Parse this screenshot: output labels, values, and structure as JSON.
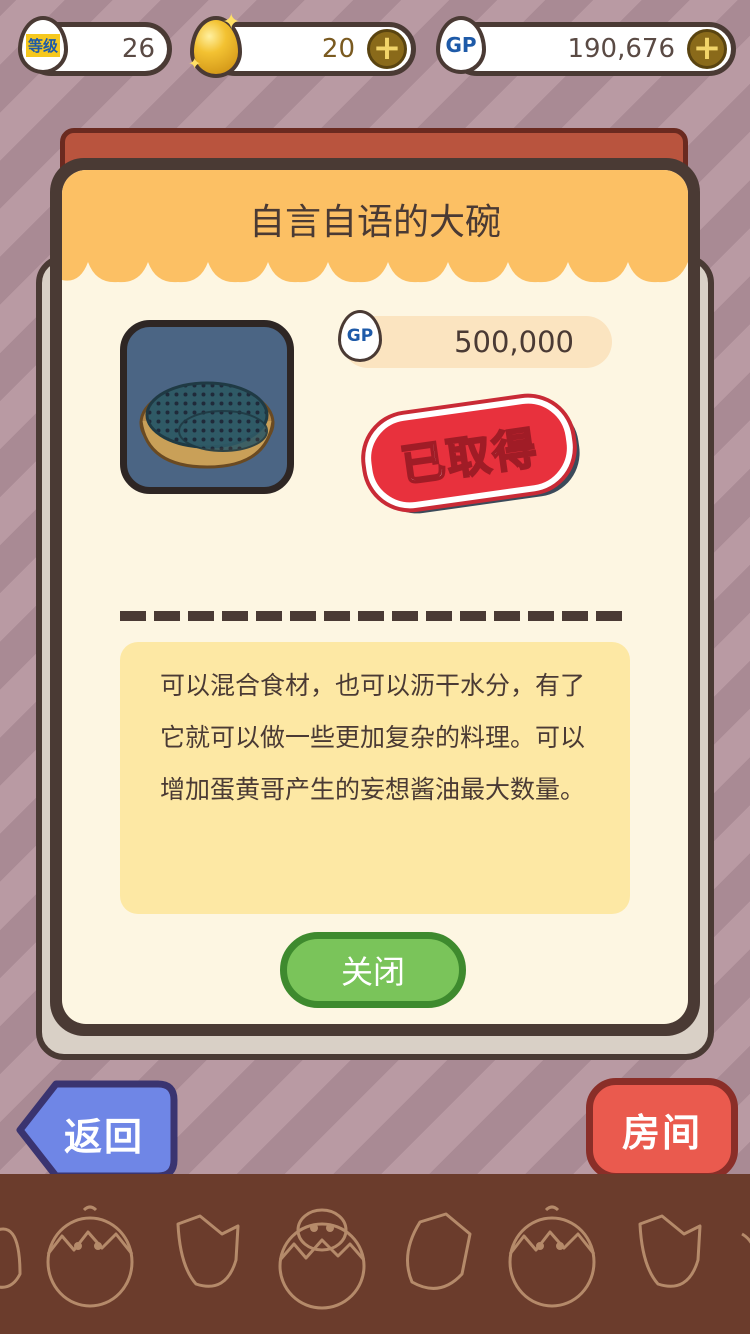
{
  "hud": {
    "level_badge": "等级",
    "level": "26",
    "golden_eggs": "20",
    "gp_badge": "GP",
    "gp": "190,676"
  },
  "dialog": {
    "title": "自言自语的大碗",
    "price_badge": "GP",
    "price": "500,000",
    "stamp": "已取得",
    "description": "可以混合食材，也可以沥干水分，有了它就可以做一些更加复杂的料理。可以增加蛋黄哥产生的妄想酱油最大数量。",
    "close_label": "关闭"
  },
  "nav": {
    "back_label": "返回",
    "room_label": "房间"
  },
  "colors": {
    "header": "#fcc064",
    "close_button": "#7ac45a",
    "room_button": "#ea5a4e",
    "back_button": "#6f86e6",
    "stamp": "#e8313d"
  }
}
